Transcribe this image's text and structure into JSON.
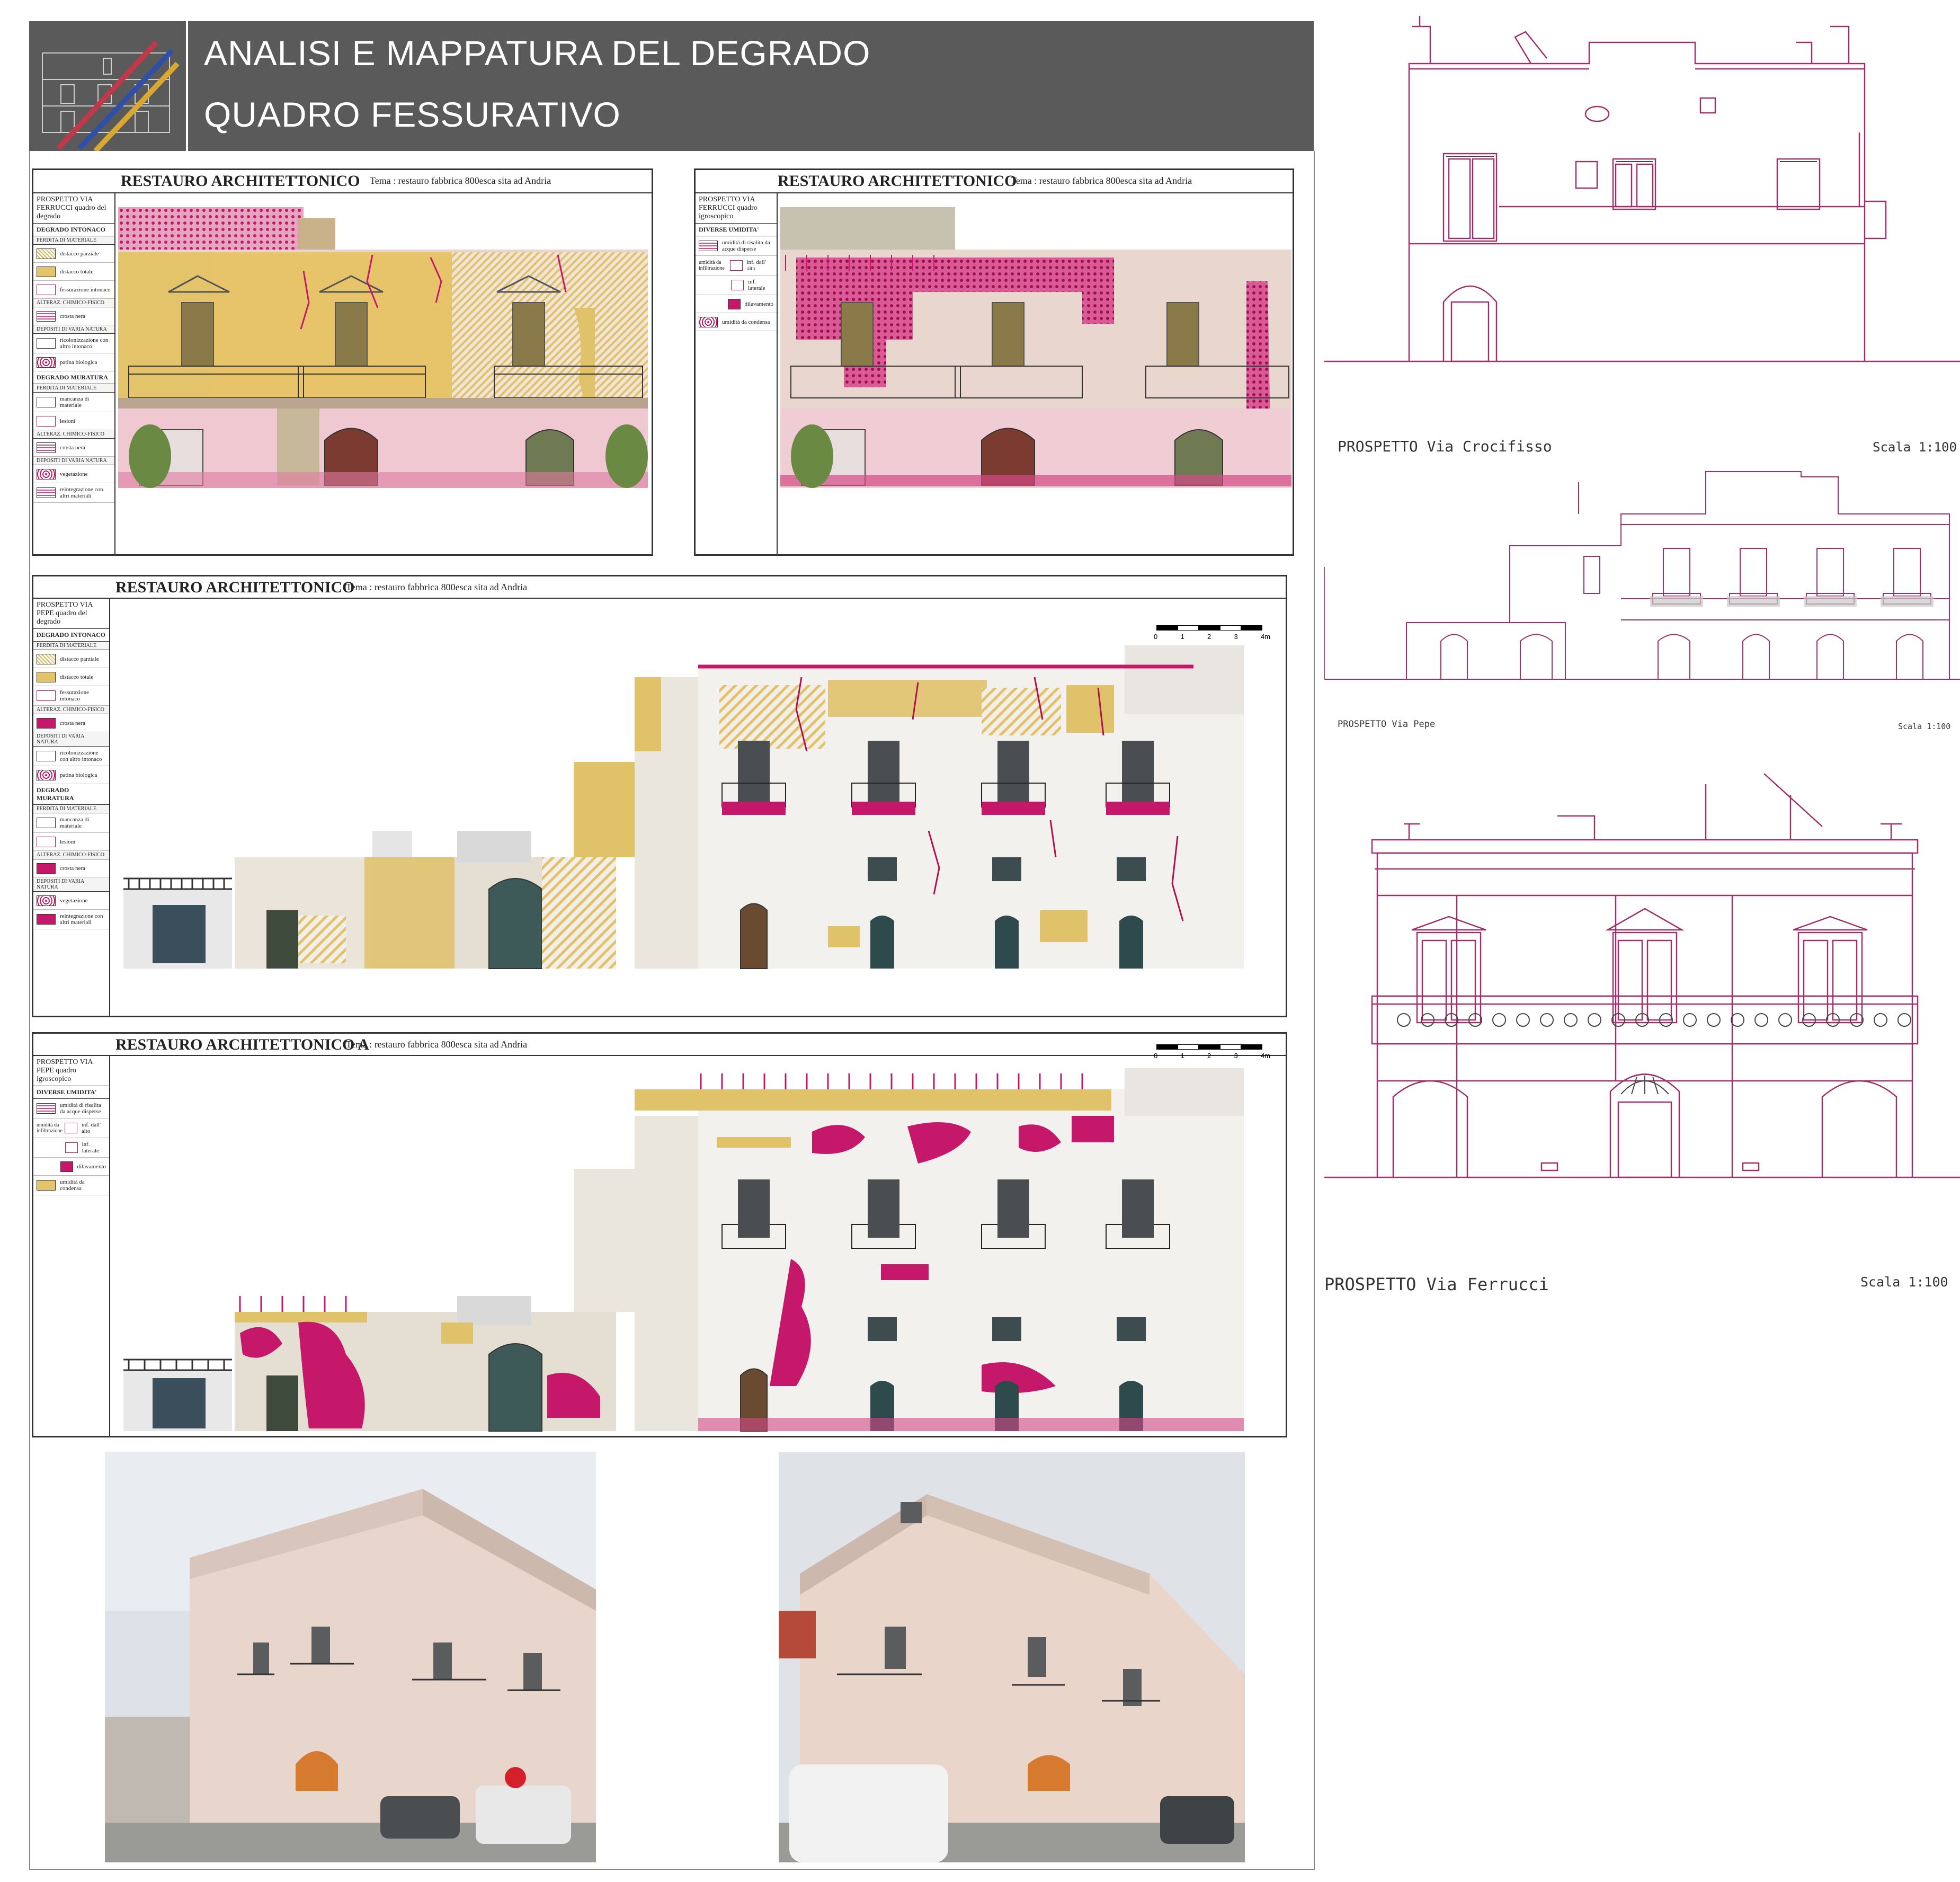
{
  "header": {
    "title_line1": "ANALISI E MAPPATURA DEL DEGRADO",
    "title_line2": "QUADRO FESSURATIVO"
  },
  "panels": {
    "common_title": "RESTAURO ARCHITETTONICO",
    "common_title_a": "RESTAURO ARCHITETTONICO  A",
    "tema": "Tema : restauro fabbrica 800esca sita ad Andria",
    "scale_ticks": [
      "0",
      "1",
      "2",
      "3",
      "4m"
    ]
  },
  "panel1_legend": {
    "head": "PROSPETTO VIA FERRUCCI  quadro del degrado",
    "sec_intonaco": "DEGRADO INTONACO",
    "sub_perdita": "PERDITA DI MATERIALE",
    "distacco_parziale": "distacco parziale",
    "distacco_totale": "distacco totale",
    "fessurazione": "fessurazione intonaco",
    "sub_alterazione": "ALTERAZ. CHIMICO-FISICO",
    "crosta_nera": "crosta nera",
    "sub_depositi": "DEPOSITI DI VARIA NATURA",
    "ricolonizzazione": "ricolonizzazione con altro intonaco",
    "patina": "patina biologica",
    "sec_muratura": "DEGRADO MURATURA",
    "sub_perdita_m": "PERDITA DI MATERIALE",
    "mancanza": "mancanza di materiale",
    "lesioni": "lesioni",
    "sub_alterazione_m": "ALTERAZ. CHIMICO-FISICO",
    "crosta_nera_m": "crosta nera",
    "sub_depositi_m": "DEPOSITI DI VARIA NATURA",
    "vegetazione": "vegetazione",
    "reintegrazione": "reintegrazione con altri materiali"
  },
  "panel2_legend": {
    "head": "PROSPETTO VIA FERRUCCI  quadro igroscopico",
    "sec": "DIVERSE UMIDITA'",
    "risalita": "umidità di risalita da acque disperse",
    "infiltrazione_label": "umidità da infiltrazione",
    "inf_alto": "inf. dall' alto",
    "inf_laterale": "inf. laterale",
    "dilavamento": "dilavamento",
    "condensa": "umidità da condensa"
  },
  "panel3_legend": {
    "head": "PROSPETTO VIA PEPE  quadro del degrado"
  },
  "panel4_legend": {
    "head": "PROSPETTO VIA PEPE  quadro igroscopico",
    "sec": "DIVERSE UMIDITA'"
  },
  "elevations": {
    "crocifisso_label": "PROSPETTO  Via  Crocifisso",
    "crocifisso_scale": "Scala  1:100",
    "pepe_label": "PROSPETTO  Via  Pepe",
    "pepe_scale": "Scala 1:100",
    "ferrucci_label": "PROSPETTO  Via  Ferrucci",
    "ferrucci_scale": "Scala  1:100"
  },
  "colors": {
    "header_bg": "#5a5a5a",
    "degrado_yellow": "#e3c46b",
    "degrado_magenta": "#c6186a",
    "elevation_line": "#a0306a"
  }
}
